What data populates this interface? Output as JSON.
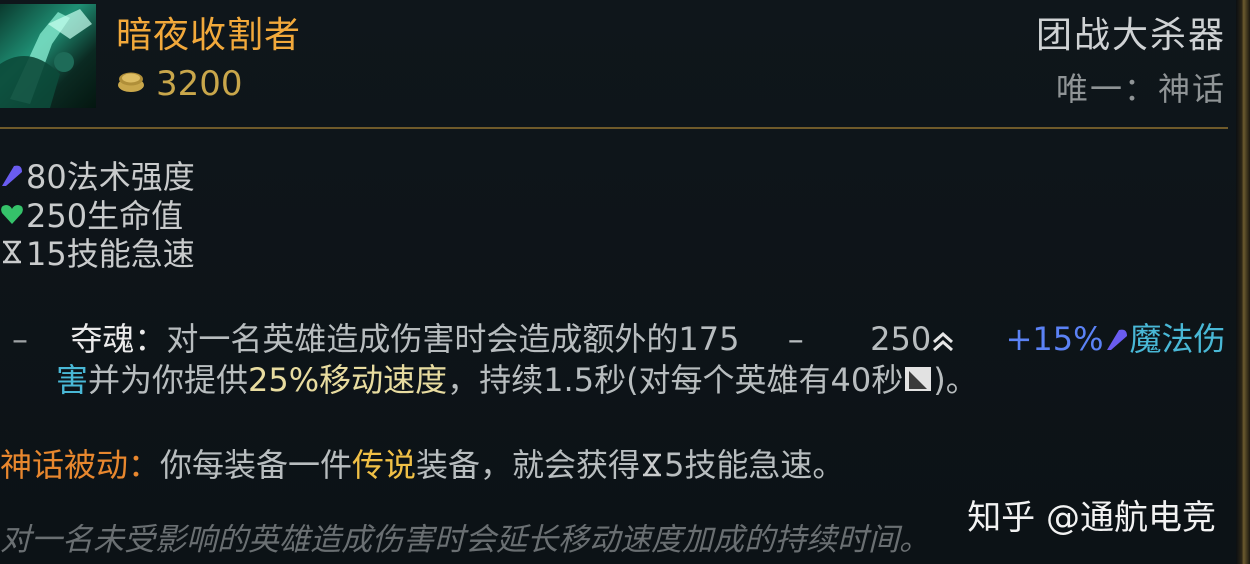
{
  "item": {
    "name": "暗夜收割者",
    "gold": "3200",
    "category": "团战大杀器",
    "unique": "唯一：神话"
  },
  "stats": [
    {
      "icon": "ability-power-icon",
      "value": "80法术强度"
    },
    {
      "icon": "health-icon",
      "value": "250生命值"
    },
    {
      "icon": "ability-haste-icon",
      "value": "15技能急速"
    }
  ],
  "passive1": {
    "dash": "–",
    "name": "夺魂：",
    "text1": "对一名英雄造成伤害时会造成额外的175",
    "dash2": "–",
    "num": "250",
    "ratio": "+15%",
    "damage_type_1": "魔法伤",
    "damage_type_2": "害",
    "text2": "并为你提供",
    "speed": "25%移动速度",
    "text3": "，持续1.5秒(对每个英雄有40秒",
    "text4": ")。"
  },
  "mythic": {
    "label": "神话被动：",
    "text1": "你每装备一件",
    "legendary": "传说",
    "text2": "装备，就会获得",
    "text3": "5技能急速。"
  },
  "flavor": "对一名未受影响的英雄造成伤害时会延长移动速度加成的持续时间。",
  "watermark": "知乎 @通航电竞",
  "colors": {
    "title": "#f2a93b",
    "gold": "#c9a74b",
    "ability_power": "#5b82f5",
    "magic_damage": "#49b8d6",
    "mythic_label": "#e8872e",
    "divider": "#6f5a2a"
  }
}
